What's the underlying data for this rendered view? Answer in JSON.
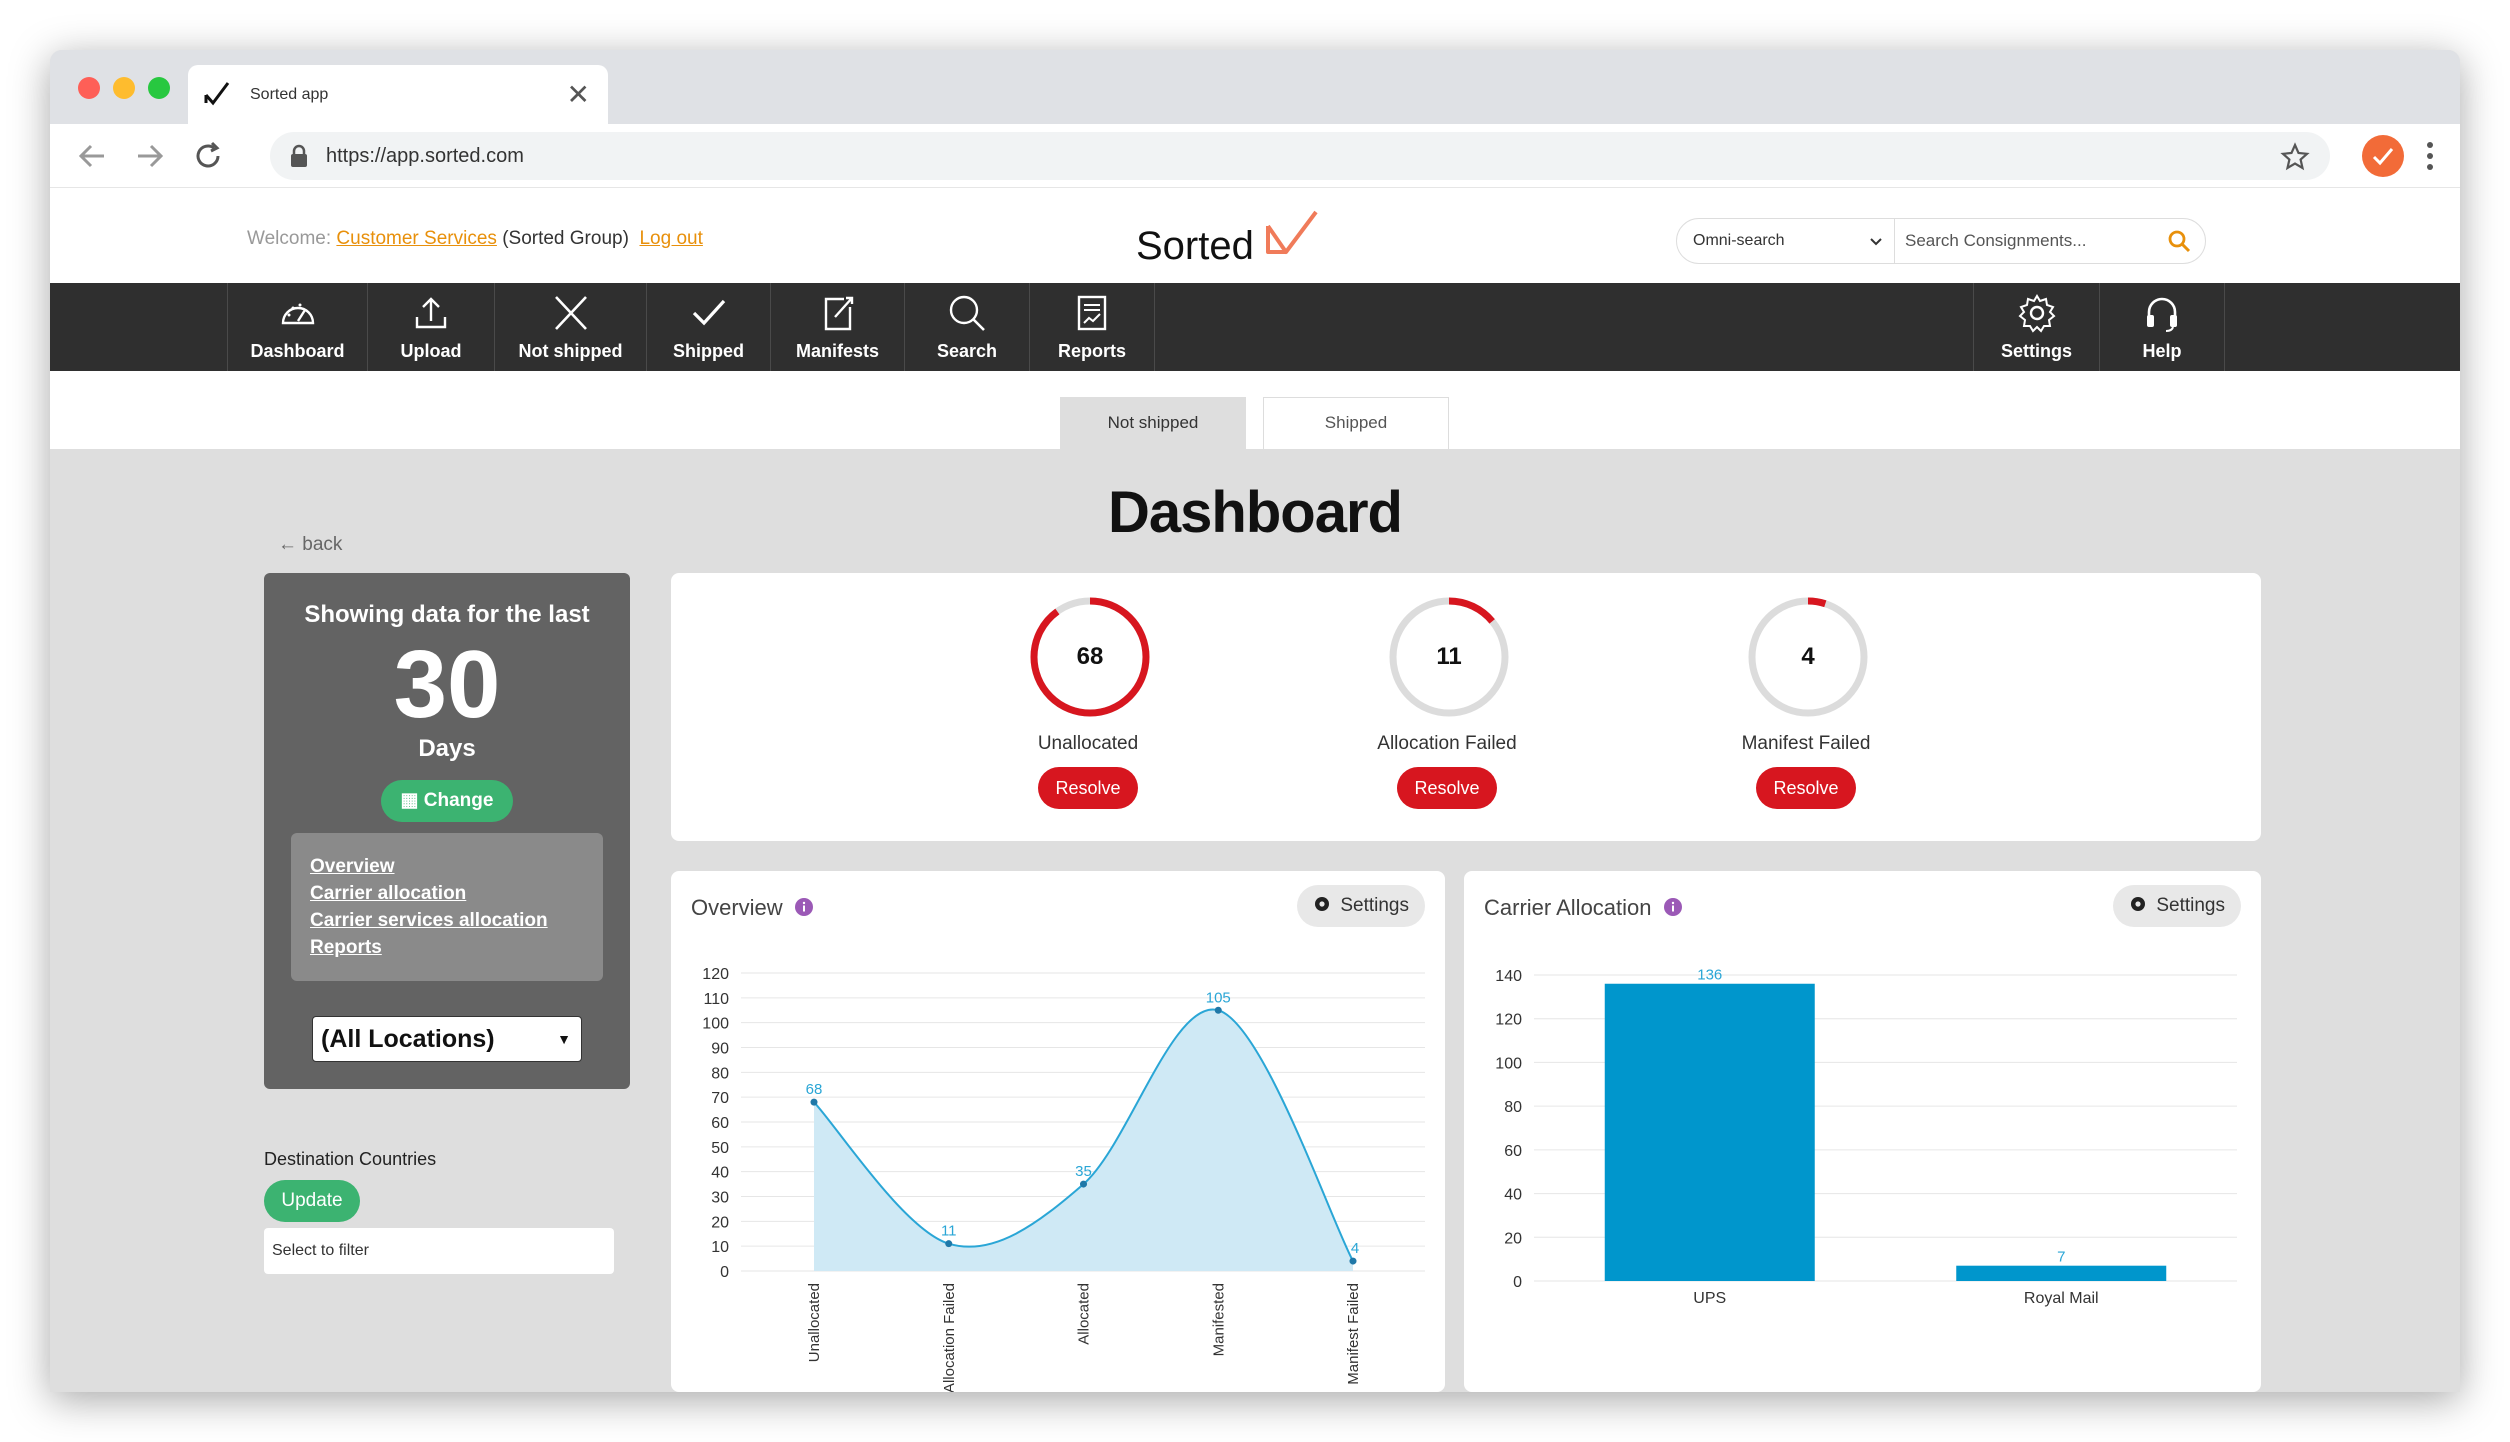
{
  "browser": {
    "tab_title": "Sorted app",
    "url": "https://app.sorted.com"
  },
  "header": {
    "welcome_prefix": "Welcome:",
    "user_name": "Customer Services",
    "group": "(Sorted Group)",
    "logout": "Log out",
    "brand": "Sorted",
    "omni_select": "Omni-search",
    "search_placeholder": "Search Consignments..."
  },
  "nav": {
    "items": [
      {
        "label": "Dashboard",
        "icon": "dashboard-gauge-icon"
      },
      {
        "label": "Upload",
        "icon": "upload-icon"
      },
      {
        "label": "Not shipped",
        "icon": "x-icon"
      },
      {
        "label": "Shipped",
        "icon": "check-icon"
      },
      {
        "label": "Manifests",
        "icon": "manifest-icon"
      },
      {
        "label": "Search",
        "icon": "search-icon"
      },
      {
        "label": "Reports",
        "icon": "report-icon"
      },
      {
        "label": "Settings",
        "icon": "gear-icon"
      },
      {
        "label": "Help",
        "icon": "headset-icon"
      }
    ]
  },
  "subtabs": {
    "not_shipped": "Not shipped",
    "shipped": "Shipped"
  },
  "dashboard": {
    "title": "Dashboard",
    "back": "back",
    "period_heading": "Showing data for the last",
    "period_value": "30",
    "period_unit": "Days",
    "change_label": "Change",
    "links": [
      "Overview",
      "Carrier allocation",
      "Carrier services allocation",
      "Reports"
    ],
    "location": "(All Locations)",
    "destination_label": "Destination Countries",
    "update_label": "Update",
    "filter_placeholder": "Select to filter"
  },
  "stats": [
    {
      "value": "68",
      "label": "Unallocated",
      "action": "Resolve",
      "fraction": 0.9
    },
    {
      "value": "11",
      "label": "Allocation Failed",
      "action": "Resolve",
      "fraction": 0.14
    },
    {
      "value": "4",
      "label": "Manifest Failed",
      "action": "Resolve",
      "fraction": 0.05
    }
  ],
  "colors": {
    "accent_orange": "#e8900b",
    "nav_bg": "#2f2f2f",
    "resolve_red": "#d7161f",
    "ring_red": "#d7161f",
    "ring_grey": "#dcdcdc",
    "green": "#3cb371",
    "chart_blue": "#0096cc",
    "area_fill": "#cfe9f5"
  },
  "chart_data": [
    {
      "type": "area",
      "title": "Overview",
      "settings_label": "Settings",
      "categories": [
        "Unallocated",
        "Allocation Failed",
        "Allocated",
        "Manifested",
        "Manifest Failed"
      ],
      "values": [
        68,
        11,
        35,
        105,
        4
      ],
      "ylim": [
        0,
        120
      ],
      "yticks": [
        0,
        10,
        20,
        30,
        40,
        50,
        60,
        70,
        80,
        90,
        100,
        110,
        120
      ],
      "grid": true
    },
    {
      "type": "bar",
      "title": "Carrier Allocation",
      "settings_label": "Settings",
      "categories": [
        "UPS",
        "Royal Mail"
      ],
      "values": [
        136,
        7
      ],
      "ylim": [
        0,
        140
      ],
      "yticks": [
        0,
        20,
        40,
        60,
        80,
        100,
        120,
        140
      ],
      "grid": true
    }
  ]
}
